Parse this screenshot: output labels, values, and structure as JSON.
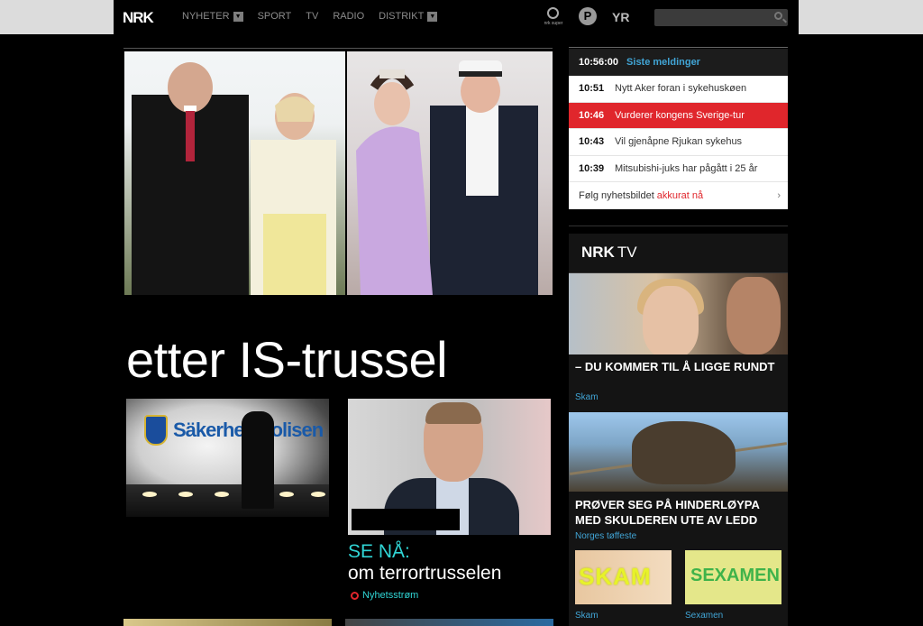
{
  "header": {
    "logo_text": "NRK",
    "nav": [
      {
        "label": "NYHETER",
        "has_dropdown": true
      },
      {
        "label": "SPORT",
        "has_dropdown": false
      },
      {
        "label": "TV",
        "has_dropdown": false
      },
      {
        "label": "RADIO",
        "has_dropdown": false
      },
      {
        "label": "DISTRIKT",
        "has_dropdown": true
      }
    ],
    "super_label": "nrk super",
    "p3_label": "P",
    "yr_label": "YR",
    "search_placeholder": ""
  },
  "main": {
    "headline": "etter IS-trussel",
    "teaser1_sign": "Säkerhetspolisen",
    "live_label": "SE NÅ:",
    "live_title": "om terrortrusselen",
    "live_source": "Nyhetsstrøm"
  },
  "ticker": {
    "clock": "10:56:00",
    "title": "Siste meldinger",
    "items": [
      {
        "time": "10:51",
        "text": "Nytt Aker foran i sykehuskøen",
        "active": false
      },
      {
        "time": "10:46",
        "text": "Vurderer kongens Sverige-tur",
        "active": true
      },
      {
        "time": "10:43",
        "text": "Vil gjenåpne Rjukan sykehus",
        "active": false
      },
      {
        "time": "10:39",
        "text": "Mitsubishi-juks har pågått i 25 år",
        "active": false
      }
    ],
    "follow_text": "Følg nyhetsbildet",
    "follow_accent": "akkurat nå",
    "follow_chevron": "›"
  },
  "tv": {
    "logo": "NRK",
    "suffix": "TV",
    "items": [
      {
        "title": "– DU KOMMER TIL Å LIGGE RUNDT",
        "category": "Skam"
      },
      {
        "title": "PRØVER SEG PÅ HINDERLØYPA MED SKULDEREN UTE AV LEDD",
        "category": "Norges tøffeste"
      }
    ],
    "tiles": [
      {
        "word": "SKAM",
        "caption": "Skam"
      },
      {
        "word": "SEXAMEN",
        "caption": "Sexamen"
      }
    ]
  },
  "colors": {
    "accent_red": "#e0262c",
    "accent_blue": "#41a5d6",
    "live_cyan": "#30d5d5"
  }
}
